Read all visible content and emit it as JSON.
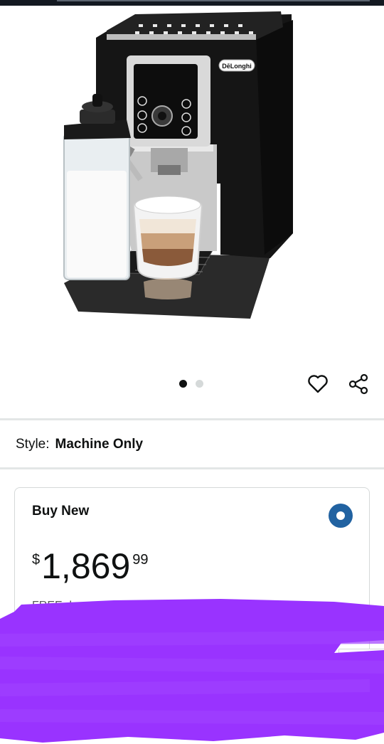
{
  "gallery": {
    "brand_logo_text": "DēLonghi",
    "active_dot": 1,
    "total_dots": 2
  },
  "actions": {
    "favorite_icon": "heart-icon",
    "share_icon": "share-icon"
  },
  "style": {
    "label": "Style:",
    "value": "Machine Only"
  },
  "buy_new": {
    "title": "Buy New",
    "price_symbol": "$",
    "price_whole": "1,869",
    "price_fraction": "99",
    "selected": true,
    "partial_text": "FREE d"
  },
  "colors": {
    "accent_radio": "#2162a1",
    "redaction": "#9933ff",
    "divider": "#e3e6e6"
  }
}
